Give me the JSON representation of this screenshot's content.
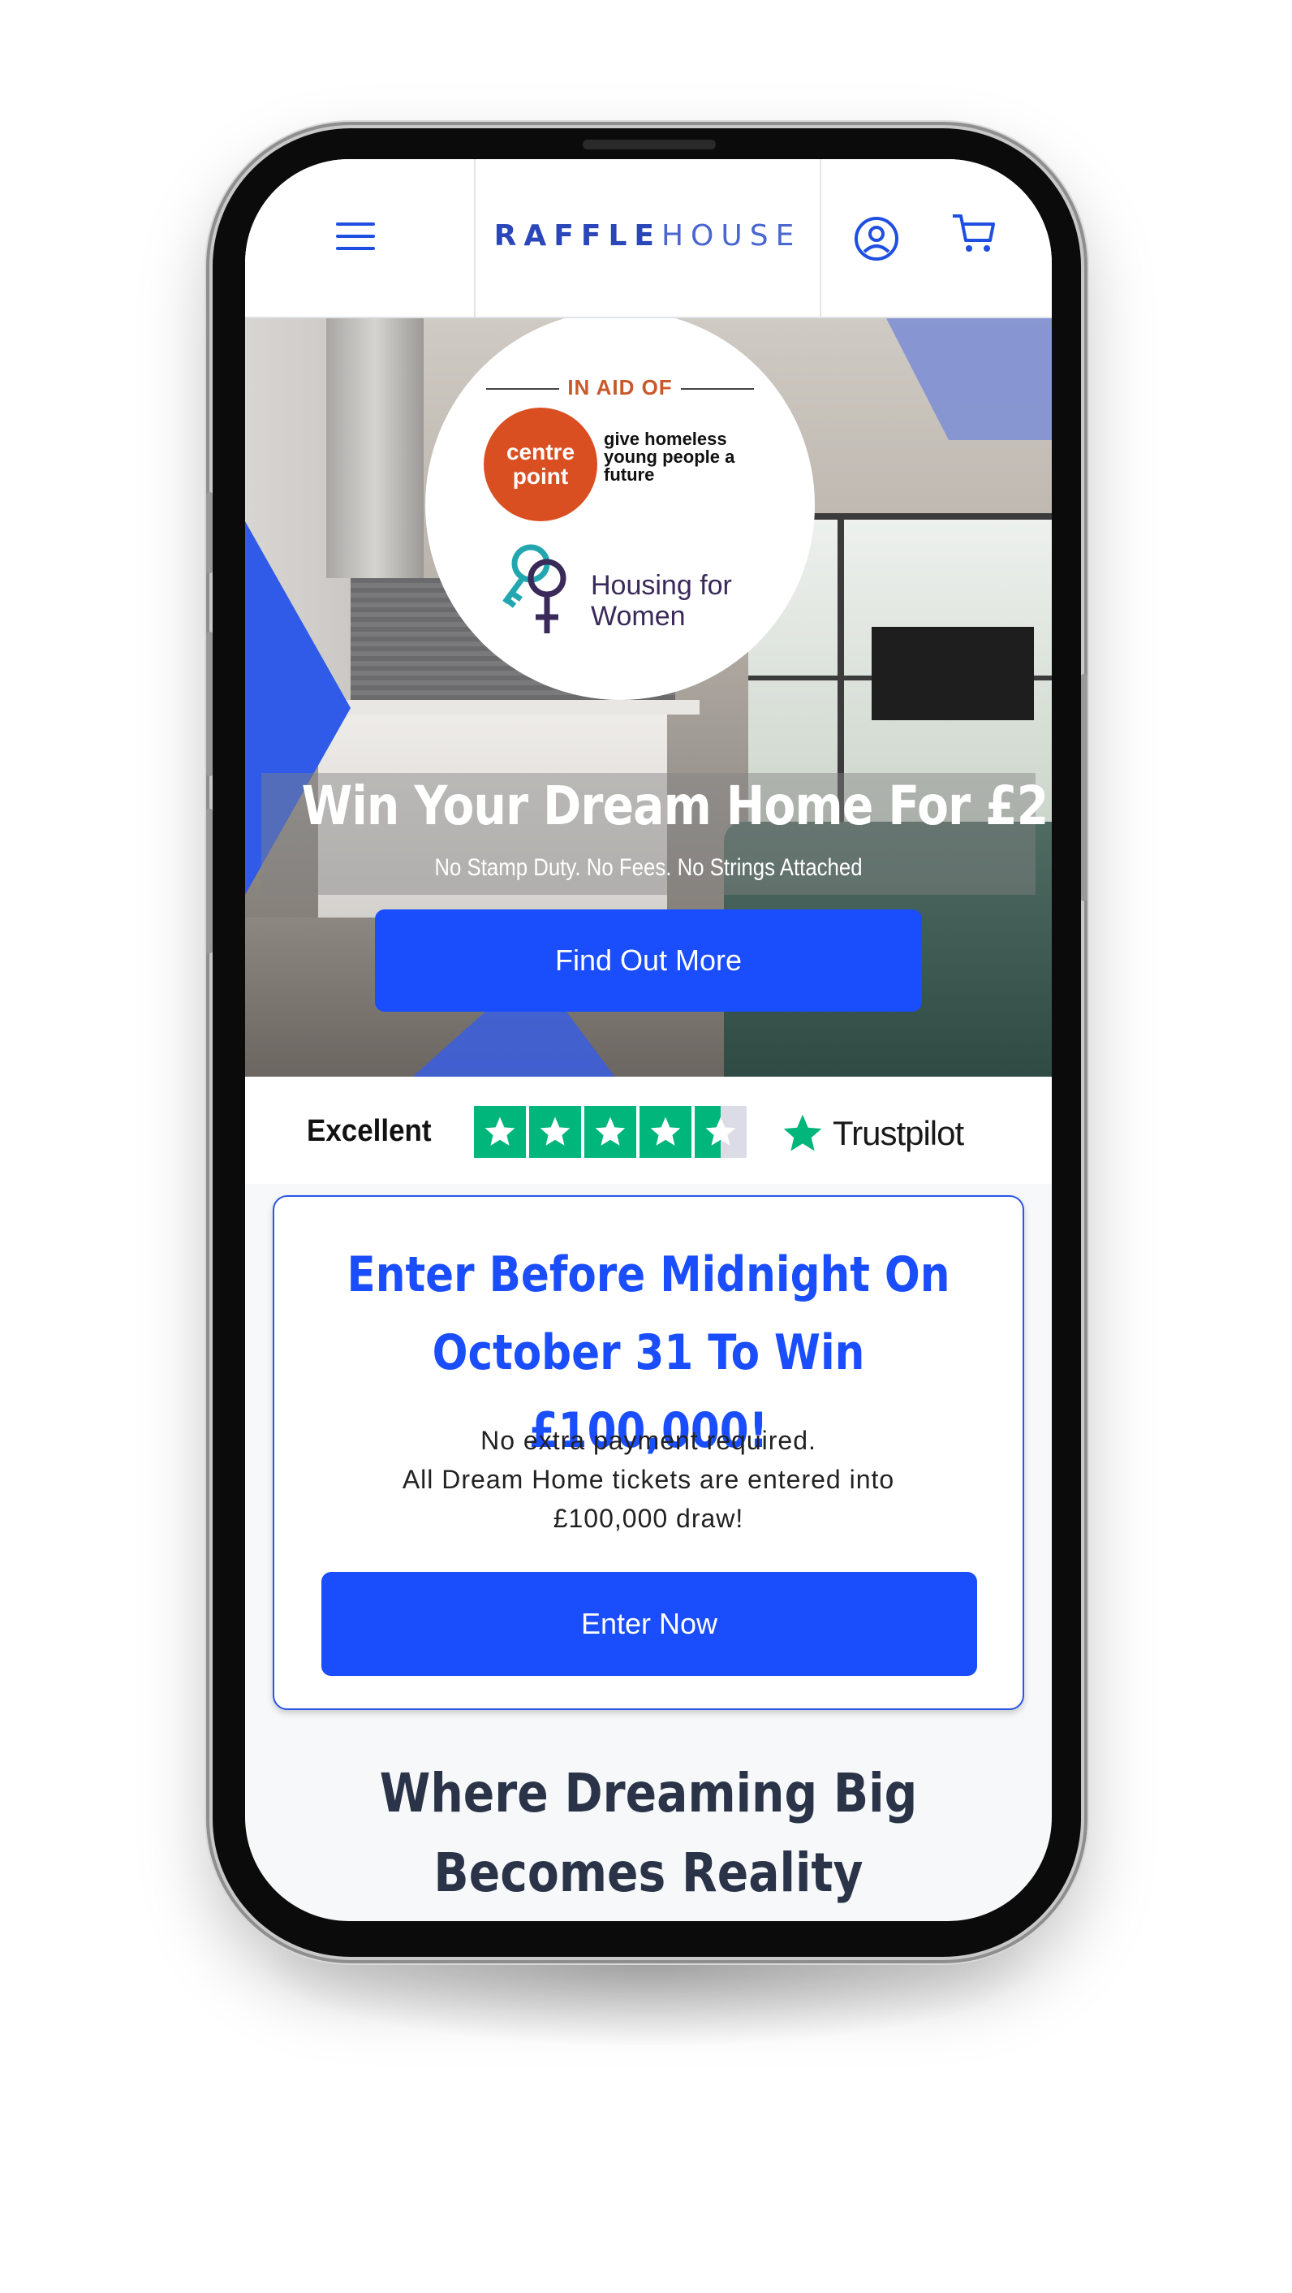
{
  "header": {
    "brand_bold": "RAFFLE",
    "brand_light": "HOUSE"
  },
  "hero": {
    "charity": {
      "in_aid_label": "IN AID OF",
      "centrepoint_badge": "centre point",
      "centrepoint_tagline": "give homeless young people a future",
      "housing_for_women": "Housing for Women"
    },
    "title": "Win Your Dream Home For £2",
    "subtitle": "No Stamp Duty. No Fees. No Strings Attached",
    "cta_label": "Find Out More"
  },
  "trustpilot": {
    "rating_word": "Excellent",
    "stars": 4.5,
    "brand": "Trustpilot",
    "star_color": "#00b67a"
  },
  "promo": {
    "title_line1": "Enter Before Midnight On",
    "title_line2": "October 31 To Win £100,000!",
    "desc_line1": "No extra payment required.",
    "desc_line2": "All Dream Home tickets are entered into",
    "desc_line3": "£100,000 draw!",
    "cta_label": "Enter Now"
  },
  "section": {
    "title_line1": "Where Dreaming Big",
    "title_line2": "Becomes Reality"
  },
  "colors": {
    "accent": "#1a4dfb",
    "heading_dark": "#2a3347",
    "brand_orange": "#d94f22"
  }
}
